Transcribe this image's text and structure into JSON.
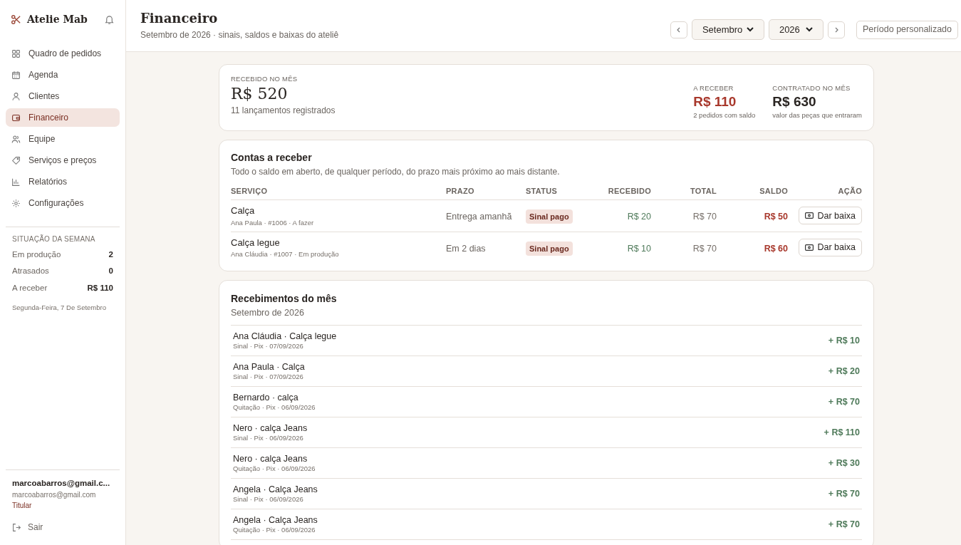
{
  "sidebar": {
    "brand": "Atelie Mab",
    "items": [
      {
        "label": "Quadro de pedidos",
        "selected": false
      },
      {
        "label": "Agenda",
        "selected": false
      },
      {
        "label": "Clientes",
        "selected": false
      },
      {
        "label": "Financeiro",
        "selected": true
      },
      {
        "label": "Equipe",
        "selected": false
      },
      {
        "label": "Serviços e preços",
        "selected": false
      },
      {
        "label": "Relatórios",
        "selected": false
      },
      {
        "label": "Configurações",
        "selected": false
      }
    ],
    "week": {
      "title": "SITUAÇÃO DA SEMANA",
      "rows": [
        {
          "label": "Em produção",
          "value": "2"
        },
        {
          "label": "Atrasados",
          "value": "0"
        },
        {
          "label": "A receber",
          "value": "R$ 110"
        }
      ],
      "date": "Segunda-Feira, 7 De Setembro"
    },
    "user": {
      "name": "marcoabarros@gmail.c...",
      "email": "marcoabarros@gmail.com",
      "role": "Titular"
    },
    "logout": "Sair"
  },
  "header": {
    "title": "Financeiro",
    "subtitle": "Setembro de 2026 · sinais, saldos e baixas do ateliê",
    "month": "Setembro",
    "year": "2026",
    "custom": "Período personalizado"
  },
  "summary": {
    "label": "RECEBIDO NO MÊS",
    "value": "R$ 520",
    "note": "11 lançamentos registrados",
    "stats": [
      {
        "label": "A RECEBER",
        "value": "R$ 110",
        "note": "2 pedidos com saldo",
        "highlight": true
      },
      {
        "label": "CONTRATADO NO MÊS",
        "value": "R$ 630",
        "note": "valor das peças que entraram",
        "highlight": false
      }
    ]
  },
  "receivables": {
    "title": "Contas a receber",
    "subtitle": "Todo o saldo em aberto, de qualquer período, do prazo mais próximo ao mais distante.",
    "columns": [
      "SERVIÇO",
      "PRAZO",
      "STATUS",
      "RECEBIDO",
      "TOTAL",
      "SALDO",
      "AÇÃO"
    ],
    "rows": [
      {
        "service": "Calça",
        "detail": "Ana Paula · #1006 · A fazer",
        "deadline": "Entrega amanhã",
        "status": "Sinal pago",
        "received": "R$ 20",
        "total": "R$ 70",
        "balance": "R$ 50",
        "action": "Dar baixa"
      },
      {
        "service": "Calça legue",
        "detail": "Ana Cláudia · #1007 · Em produção",
        "deadline": "Em 2 dias",
        "status": "Sinal pago",
        "received": "R$ 10",
        "total": "R$ 70",
        "balance": "R$ 60",
        "action": "Dar baixa"
      }
    ]
  },
  "payments": {
    "title": "Recebimentos do mês",
    "subtitle": "Setembro de 2026",
    "rows": [
      {
        "title": "Ana Cláudia · Calça legue",
        "detail": "Sinal · Pix · 07/09/2026",
        "amount": "+ R$ 10"
      },
      {
        "title": "Ana Paula · Calça",
        "detail": "Sinal · Pix · 07/09/2026",
        "amount": "+ R$ 20"
      },
      {
        "title": "Bernardo · calça",
        "detail": "Quitação · Pix · 06/09/2026",
        "amount": "+ R$ 70"
      },
      {
        "title": "Nero · calça Jeans",
        "detail": "Sinal · Pix · 06/09/2026",
        "amount": "+ R$ 110"
      },
      {
        "title": "Nero · calça Jeans",
        "detail": "Quitação · Pix · 06/09/2026",
        "amount": "+ R$ 30"
      },
      {
        "title": "Angela · Calça Jeans",
        "detail": "Sinal · Pix · 06/09/2026",
        "amount": "+ R$ 70"
      },
      {
        "title": "Angela · Calça Jeans",
        "detail": "Quitação · Pix · 06/09/2026",
        "amount": "+ R$ 70"
      }
    ]
  }
}
